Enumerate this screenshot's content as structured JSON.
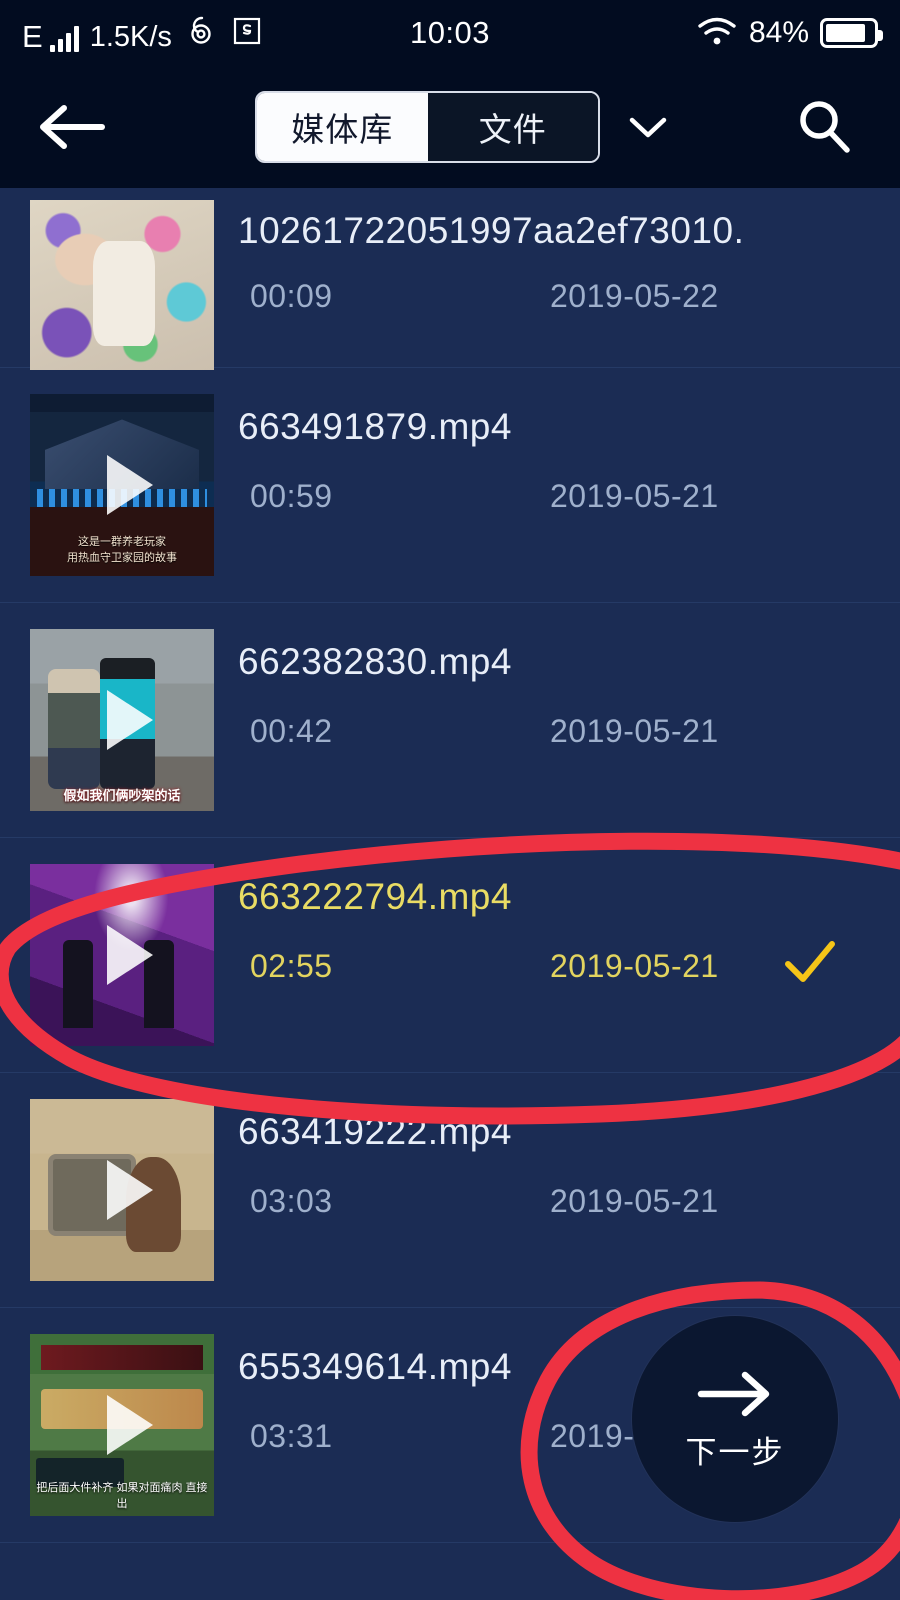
{
  "status_bar": {
    "network_type": "E",
    "data_speed": "1.5K/s",
    "clock": "10:03",
    "battery_percent": "84%",
    "battery_level": 84,
    "icons": [
      "signal-bars-icon",
      "netease-music-icon",
      "s-box-icon",
      "wifi-icon",
      "battery-icon"
    ]
  },
  "header": {
    "back_icon": "arrow-left-icon",
    "tabs": [
      {
        "label": "媒体库",
        "active": true
      },
      {
        "label": "文件",
        "active": false
      }
    ],
    "dropdown_icon": "chevron-down-icon",
    "search_icon": "search-icon"
  },
  "colors": {
    "background": "#1b2c54",
    "header_background": "#020c20",
    "selected_text": "#e9dc64",
    "check_mark": "#f5c518",
    "annotation_red": "#ee3242",
    "divider": "#253a66",
    "muted_text": "#9fb0cc"
  },
  "list": {
    "items": [
      {
        "filename": "10261722051997aa2ef73010.",
        "duration": "00:09",
        "date": "2019-05-22",
        "selected": false,
        "thumb_class": "tn1",
        "thumb_subtitle": ""
      },
      {
        "filename": "663491879.mp4",
        "duration": "00:59",
        "date": "2019-05-21",
        "selected": false,
        "thumb_class": "tn2",
        "thumb_subtitle": "这是一群养老玩家\n用热血守卫家园的故事"
      },
      {
        "filename": "662382830.mp4",
        "duration": "00:42",
        "date": "2019-05-21",
        "selected": false,
        "thumb_class": "tn3",
        "thumb_subtitle": "假如我们俩吵架的话"
      },
      {
        "filename": "663222794.mp4",
        "duration": "02:55",
        "date": "2019-05-21",
        "selected": true,
        "thumb_class": "tn4",
        "thumb_subtitle": ""
      },
      {
        "filename": "663419222.mp4",
        "duration": "03:03",
        "date": "2019-05-21",
        "selected": false,
        "thumb_class": "tn5",
        "thumb_subtitle": ""
      },
      {
        "filename": "655349614.mp4",
        "duration": "03:31",
        "date": "2019-05",
        "selected": false,
        "thumb_class": "tn6",
        "thumb_subtitle": "把后面大件补齐 如果对面痛肉 直接出"
      }
    ]
  },
  "fab": {
    "label": "下一步",
    "icon": "arrow-right-icon"
  },
  "annotations": {
    "selected_row_circle": "hand-drawn red oval around selected video row",
    "fab_circle": "hand-drawn red oval around next-step button"
  }
}
